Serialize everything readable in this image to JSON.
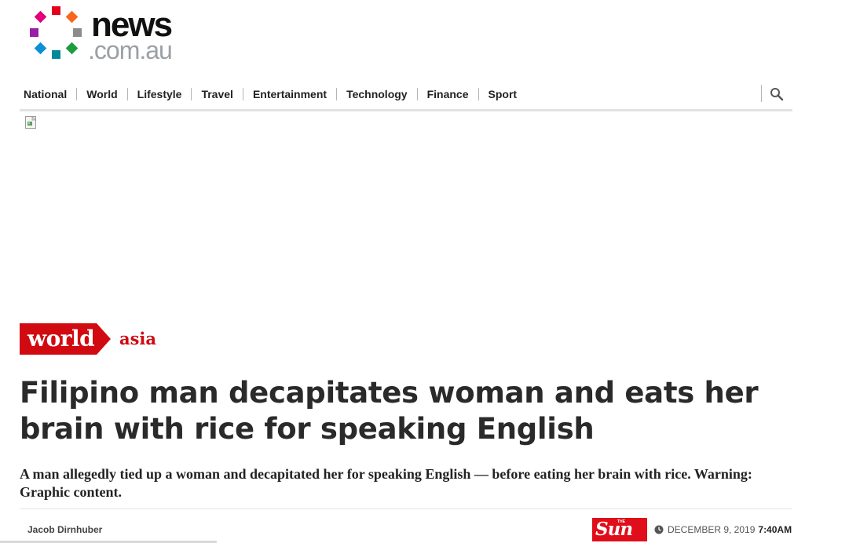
{
  "logo": {
    "word": "news",
    "domain": ".com.au",
    "dot_colors": [
      "#e2007a",
      "#e3001b",
      "#f7661c",
      "#8b8b8b",
      "#1c9c3e",
      "#008a9a",
      "#0b8fd7",
      "#9a1ea8"
    ]
  },
  "nav": {
    "items": [
      "National",
      "World",
      "Lifestyle",
      "Travel",
      "Entertainment",
      "Technology",
      "Finance",
      "Sport"
    ],
    "search_icon": "search-icon"
  },
  "article": {
    "section": "world",
    "subsection": "asia",
    "headline": "Filipino man decapitates woman and eats her brain with rice for speaking English",
    "standfirst": "A man allegedly tied up a woman and decapitated her for speaking English — before eating her brain with rice. Warning: Graphic content.",
    "author": "Jacob Dirnhuber",
    "source_logo": "Sun",
    "source_logo_small": "THE",
    "date": "DECEMBER 9, 2019",
    "time": "7:40AM"
  },
  "colors": {
    "brand_red": "#d10a11",
    "text_dark": "#2a2a2a"
  }
}
